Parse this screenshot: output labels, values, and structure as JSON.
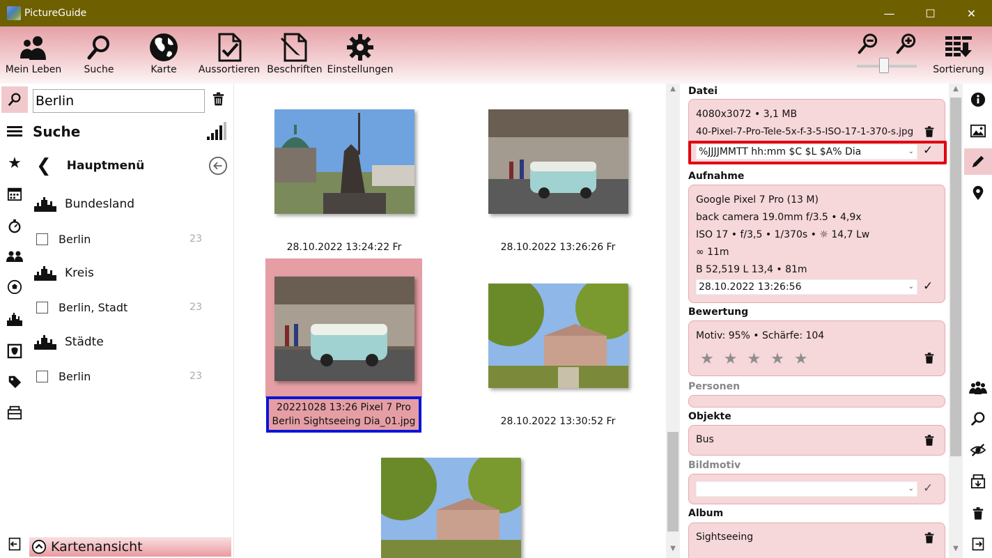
{
  "window": {
    "title": "PictureGuide",
    "minimize": "—",
    "maximize": "☐",
    "close": "✕"
  },
  "toolbar": {
    "items": [
      {
        "label": "Mein Leben",
        "icon": "people-icon"
      },
      {
        "label": "Suche",
        "icon": "search-icon"
      },
      {
        "label": "Karte",
        "icon": "globe-icon"
      },
      {
        "label": "Aussortieren",
        "icon": "document-check-icon"
      },
      {
        "label": "Beschriften",
        "icon": "document-edit-icon"
      },
      {
        "label": "Einstellungen",
        "icon": "gear-icon"
      }
    ],
    "sort_label": "Sortierung",
    "zoom_level": 0.45
  },
  "left_panel": {
    "search_value": "Berlin",
    "heading": "Suche",
    "back_label": "Hauptmenü",
    "groups": [
      {
        "title": "Bundesland",
        "item": "Berlin",
        "count": "23"
      },
      {
        "title": "Kreis",
        "item": "Berlin, Stadt",
        "count": "23"
      },
      {
        "title": "Städte",
        "item": "Berlin",
        "count": "23"
      }
    ],
    "map_toggle_label": "Kartenansicht"
  },
  "gallery": {
    "captions": [
      "28.10.2022 13:24:22 Fr",
      "28.10.2022 13:26:26 Fr",
      "28.10.2022 13:30:52 Fr"
    ],
    "selected_caption_line1": "20221028 13:26 Pixel 7 Pro",
    "selected_caption_line2": "Berlin Sightseeing Dia_01.jpg"
  },
  "details": {
    "datei": {
      "title": "Datei",
      "size": "4080x3072 • 3,1 MB",
      "filename": "40-Pixel-7-Pro-Tele-5x-f-3-5-ISO-17-1-370-s.jpg",
      "pattern": "%JJJJMMTT hh:mm $C $L $A% Dia"
    },
    "aufnahme": {
      "title": "Aufnahme",
      "camera": "Google Pixel 7 Pro (13 M)",
      "lens": "back camera 19.0mm f/3.5 • 4,9x",
      "exposure": "ISO 17 • f/3,5 • 1/370s • ☼ 14,7 Lw",
      "distance": "∞ 11m",
      "location": "B 52,519 L 13,4 • 81m",
      "date": "28.10.2022 13:26:56"
    },
    "bewertung": {
      "title": "Bewertung",
      "text": "Motiv: 95% • Schärfe: 104",
      "stars": "★★★★★"
    },
    "personen": {
      "title": "Personen"
    },
    "objekte": {
      "title": "Objekte",
      "value": "Bus"
    },
    "bildmotiv": {
      "title": "Bildmotiv",
      "value": ""
    },
    "album": {
      "title": "Album",
      "value": "Sightseeing"
    }
  },
  "colors": {
    "titlebar": "#6e5f00",
    "accent": "#e59ea4",
    "selection_border": "#0a14d8",
    "edit_frame": "#e1000f"
  }
}
